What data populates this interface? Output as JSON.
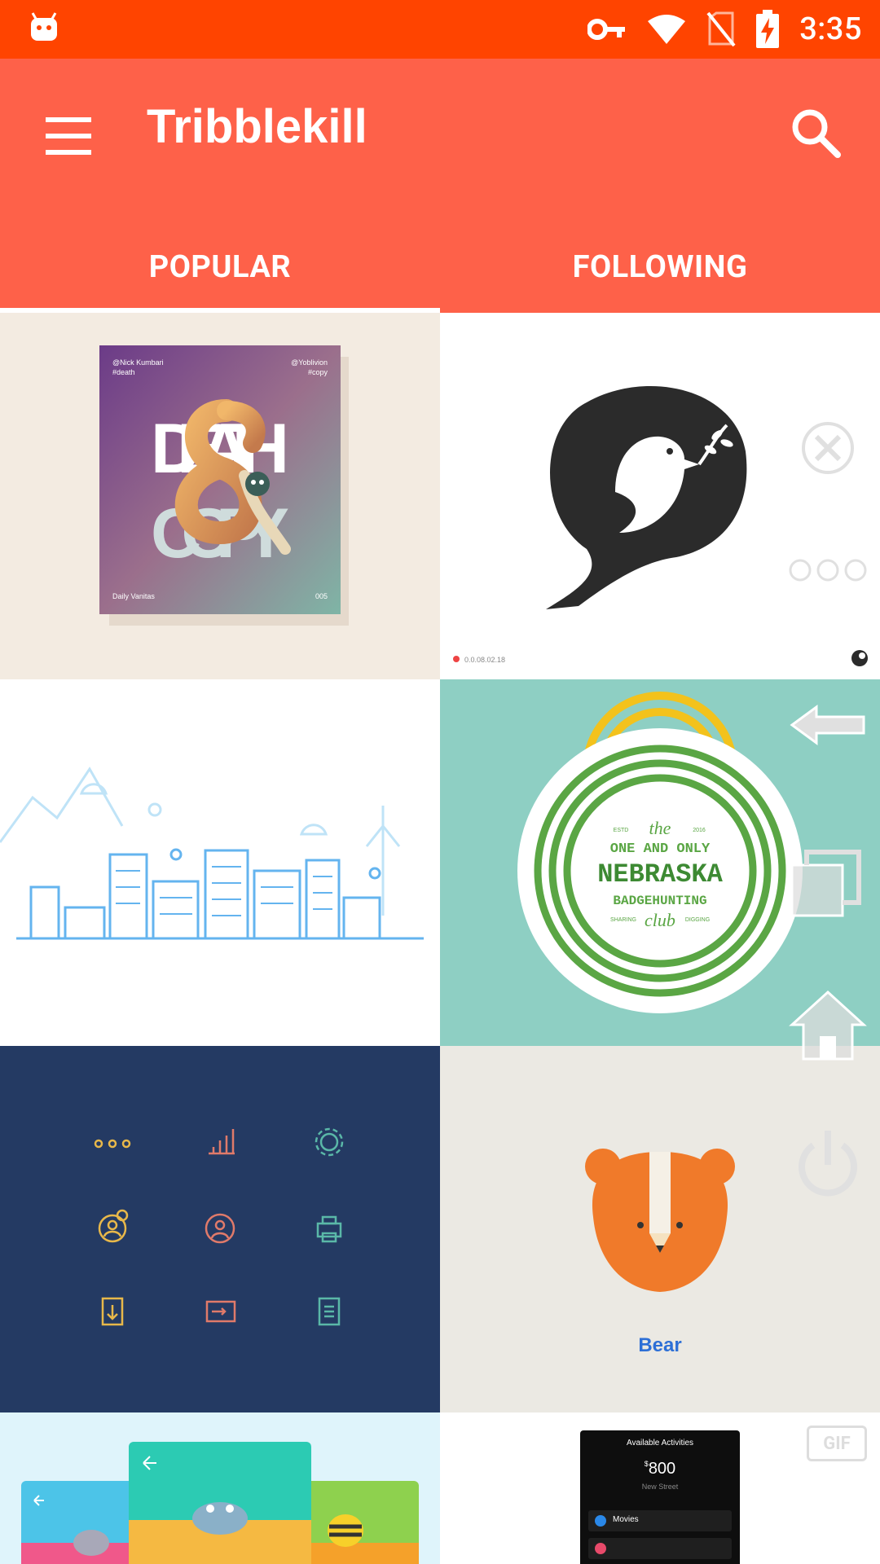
{
  "status_bar": {
    "time": "3:35",
    "icons": [
      "android-icon",
      "vpn-key-icon",
      "wifi-icon",
      "no-sim-icon",
      "battery-charging-icon"
    ]
  },
  "app_bar": {
    "title": "Tribblekill",
    "menu_icon": "menu-icon",
    "search_icon": "search-icon"
  },
  "tabs": [
    {
      "label": "POPULAR",
      "active": true
    },
    {
      "label": "FOLLOWING",
      "active": false
    }
  ],
  "shots": {
    "death_copy": {
      "handle_left": "@Nick Kumbari",
      "tag_left": "#death",
      "handle_right": "@Yoblivion",
      "tag_right": "#copy",
      "word_top": "DEATH",
      "word_bottom": "COPY",
      "footer_left": "Daily Vanitas",
      "footer_right": "005"
    },
    "dove": {
      "caption": "0.0.08.02.18"
    },
    "nebraska": {
      "est": "ESTD",
      "year": "2016",
      "the": "the",
      "line1": "ONE AND ONLY",
      "line2": "NEBRASKA",
      "line3": "BADGEHUNTING",
      "club": "club",
      "sharing": "SHARING",
      "digging": "DIGGING"
    },
    "bear": {
      "label": "Bear"
    },
    "activities": {
      "header": "Available Activities",
      "amount_sign": "$",
      "amount": "800",
      "street": "New Street",
      "item1": "Movies"
    },
    "gif_badge": "GIF"
  },
  "colors": {
    "status_bar": "#ff4400",
    "app_bar": "#fe6149",
    "nebraska_bg": "#8ecfc3",
    "navy_tile": "#243a63",
    "bear_orange": "#f07a2a"
  },
  "overlay_buttons": [
    "close-circle-icon",
    "more-dots-icon",
    "back-arrow-icon",
    "recents-icon",
    "home-icon",
    "power-icon"
  ]
}
